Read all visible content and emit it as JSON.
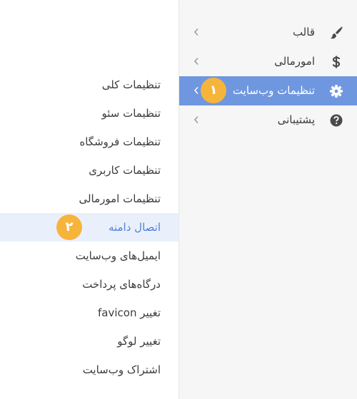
{
  "colors": {
    "active_bg": "#6f97df",
    "submenu_active_bg": "#eaf0fb",
    "submenu_active_text": "#4f82d9",
    "badge": "#f7b43b",
    "panel_bg": "#f6f6f6",
    "icon": "#4a4a4a"
  },
  "main_menu": [
    {
      "label": "قالب",
      "icon": "paintbrush-icon"
    },
    {
      "label": "امورمالی",
      "icon": "dollar-icon"
    },
    {
      "label": "تنظیمات وب‌سایت",
      "icon": "gear-icon",
      "active": true
    },
    {
      "label": "پشتیبانی",
      "icon": "question-circle-icon"
    }
  ],
  "badges": {
    "step1": "۱",
    "step2": "۲"
  },
  "submenu": [
    {
      "label": "تنظیمات کلی"
    },
    {
      "label": "تنظیمات سئو"
    },
    {
      "label": "تنظیمات فروشگاه"
    },
    {
      "label": "تنظیمات کاربری"
    },
    {
      "label": "تنظیمات امورمالی"
    },
    {
      "label": "اتصال دامنه",
      "active": true
    },
    {
      "label": "ایمیل‌های وب‌سایت"
    },
    {
      "label": "درگاه‌های پرداخت"
    },
    {
      "label": "تغییر favicon"
    },
    {
      "label": "تغییر لوگو"
    },
    {
      "label": "اشتراک وب‌سایت"
    }
  ]
}
